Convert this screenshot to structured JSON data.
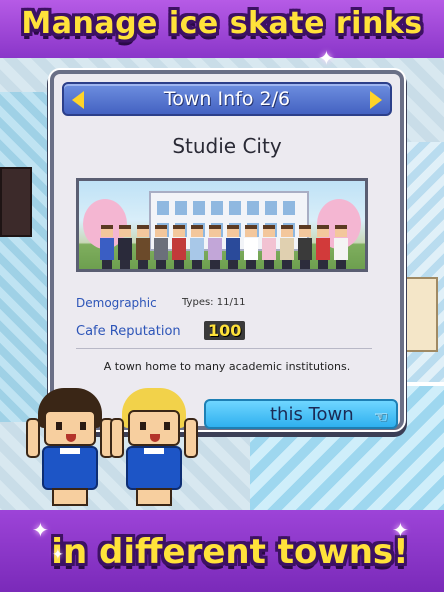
{
  "banner": {
    "top_text": "Manage ice skate rinks",
    "bottom_text": "in different towns!"
  },
  "dialog": {
    "title": "Town Info 2/6",
    "city_name": "Studie City",
    "demographic_label": "Demographic",
    "types_text": "Types: 11/11",
    "cafe_label": "Cafe Reputation",
    "cafe_value": "100",
    "description": "A town home to many academic institutions.",
    "action_label": "this Town"
  },
  "icons": {
    "prev": "chevron-left-icon",
    "next": "chevron-right-icon",
    "pointer": "pointing-hand-icon",
    "sparkle": "sparkle-icon"
  },
  "colors": {
    "banner_text": "#ffe23a",
    "banner_outline": "#3d1163",
    "background": "#9a44d6",
    "header_blue": "#4462c2",
    "button_blue": "#2fb0ef"
  }
}
